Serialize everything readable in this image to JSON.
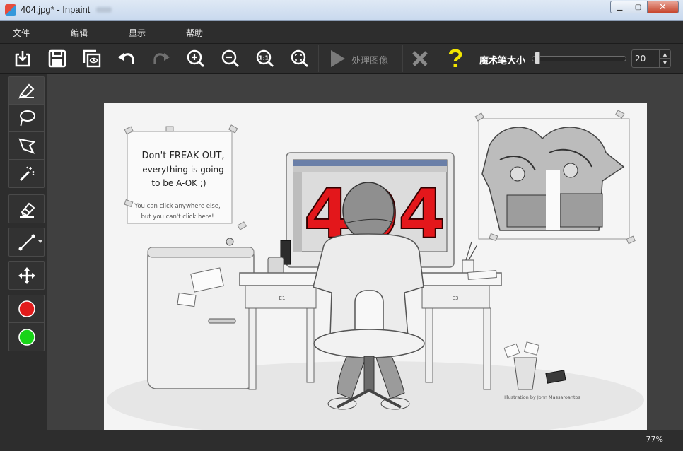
{
  "window": {
    "title": "404.jpg* - Inpaint",
    "controls": {
      "minimize": "▁",
      "maximize": "▢",
      "close": "✕"
    }
  },
  "menu": [
    {
      "label": "文件"
    },
    {
      "label": "编辑"
    },
    {
      "label": "显示"
    },
    {
      "label": "帮助"
    }
  ],
  "toolbar": {
    "process_label": "处理图像",
    "brush_size_label": "魔术笔大小",
    "brush_size_value": "20",
    "brush_size_fraction": 0.02
  },
  "colors": {
    "active_marker": "#e21b1b",
    "background_marker": "#18d418",
    "help_icon": "#f2e500"
  },
  "image": {
    "note_lines": [
      "Don't FREAK OUT,",
      "everything is going",
      "to be A-OK ;)"
    ],
    "note_small_lines": [
      "You can click anywhere else,",
      "but you can't click here!"
    ],
    "screen_text": "404",
    "drawer_left": "E1",
    "drawer_right": "E3",
    "credit": "Illustration by John Massaroantos"
  },
  "status": {
    "zoom": "77%"
  }
}
